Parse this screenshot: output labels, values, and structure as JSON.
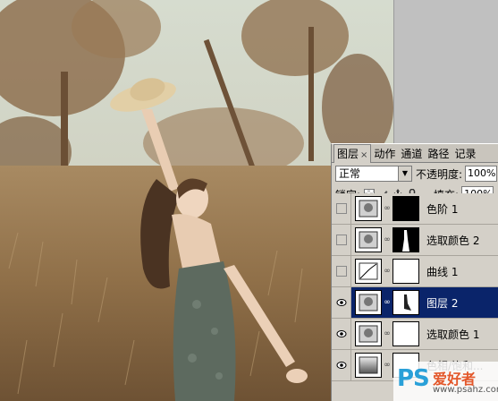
{
  "panel": {
    "tabs": [
      {
        "label": "图层",
        "active": true,
        "close": "×"
      },
      {
        "label": "动作"
      },
      {
        "label": "通道"
      },
      {
        "label": "路径"
      },
      {
        "label": "记录"
      }
    ],
    "blend_mode": "正常",
    "opacity_label": "不透明度:",
    "opacity_value": "100%",
    "lock_label": "锁定:",
    "fill_label": "填充:",
    "fill_value": "100%",
    "layers": [
      {
        "name": "色阶 1",
        "visible": false,
        "selected": false
      },
      {
        "name": "选取颜色 2",
        "visible": false,
        "selected": false
      },
      {
        "name": "曲线 1",
        "visible": false,
        "selected": false
      },
      {
        "name": "图层 2",
        "visible": true,
        "selected": true
      },
      {
        "name": "选取颜色 1",
        "visible": true,
        "selected": false
      },
      {
        "name": "色相/饱和...",
        "visible": true,
        "selected": false
      }
    ]
  },
  "watermark": {
    "brand": "PS",
    "cn": "爱好者",
    "url": "www.psahz.com"
  },
  "colors": {
    "selected": "#0a246a",
    "panel_bg": "#d4d0c8",
    "accent": "#2aa0d8"
  }
}
